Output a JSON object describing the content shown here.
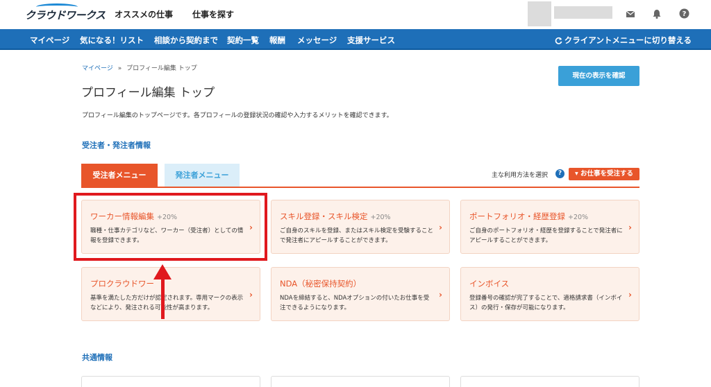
{
  "header": {
    "logo_text": "クラウドワークス",
    "nav": [
      "オススメの仕事",
      "仕事を探す"
    ]
  },
  "bluenav": {
    "items": [
      "マイページ",
      "気になる！リスト",
      "相談から契約まで",
      "契約一覧",
      "報酬",
      "メッセージ",
      "支援サービス"
    ],
    "switch_label": "クライアントメニューに切り替える"
  },
  "breadcrumb": {
    "home": "マイページ",
    "separator": "»",
    "current": "プロフィール編集 トップ"
  },
  "confirm_button": "現在の表示を確認",
  "page_title": "プロフィール編集 トップ",
  "description": "プロフィール編集のトップページです。各プロフィールの登録状況の確認や入力するメリットを確認できます。",
  "section1_title": "受注者・発注者情報",
  "tabs": {
    "active": "受注者メニュー",
    "inactive": "発注者メニュー"
  },
  "usage_label": "主な利用方法を選択",
  "help_mark": "?",
  "order_button": "▾ お仕事を受注する",
  "cards": [
    {
      "title": "ワーカー情報編集",
      "pct": "+20%",
      "desc": "職種・仕事カテゴリなど、ワーカー（受注者）としての情報を登録できます。"
    },
    {
      "title": "スキル登録・スキル検定",
      "pct": "+20%",
      "desc": "ご自身のスキルを登録、またはスキル検定を受験することで発注者にアピールすることができます。"
    },
    {
      "title": "ポートフォリオ・経歴登録",
      "pct": "+20%",
      "desc": "ご自身のポートフォリオ・経歴を登録することで発注者にアピールすることができます。"
    },
    {
      "title": "プロクラウドワー",
      "pct": "",
      "desc": "基準を満たした方だけが認定されます。専用マークの表示などにより、発注される可能性が高まります。"
    },
    {
      "title": "NDA（秘密保持契約）",
      "pct": "",
      "desc": "NDAを締結すると、NDAオプションの付いたお仕事を受注できるようになります。"
    },
    {
      "title": "インボイス",
      "pct": "",
      "desc": "登録番号の確認が完了することで、適格請求書（インボイス）の発行・保存が可能になります。"
    }
  ],
  "card_arrow": "›",
  "section2_title": "共通情報",
  "colors": {
    "brand_blue": "#1e6fb8",
    "accent_orange": "#e8552a",
    "annotation_red": "#e0191e"
  }
}
